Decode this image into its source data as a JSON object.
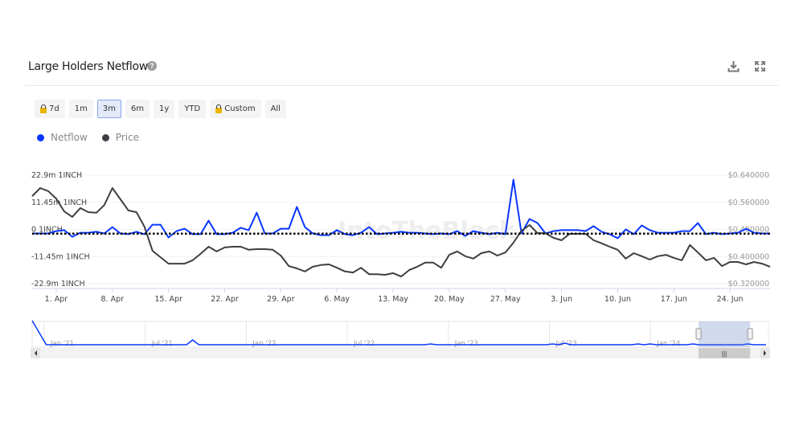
{
  "header": {
    "title": "Large Holders Netflow",
    "help_icon": "question-circle-icon",
    "download_icon": "download-icon",
    "fullscreen_icon": "expand-icon"
  },
  "range_buttons": [
    {
      "label": "7d",
      "locked": true
    },
    {
      "label": "1m",
      "locked": false
    },
    {
      "label": "3m",
      "locked": false,
      "active": true
    },
    {
      "label": "6m",
      "locked": false
    },
    {
      "label": "1y",
      "locked": false
    },
    {
      "label": "YTD",
      "locked": false
    },
    {
      "label": "Custom",
      "locked": true
    },
    {
      "label": "All",
      "locked": false
    }
  ],
  "legend": [
    {
      "label": "Netflow",
      "color": "#0a37ff"
    },
    {
      "label": "Price",
      "color": "#3d3f44"
    }
  ],
  "watermark": "IntoTheBlock",
  "chart_data": {
    "type": "line",
    "start_date": "2024-03-29",
    "x_tick_labels": [
      "1. Apr",
      "8. Apr",
      "15. Apr",
      "22. Apr",
      "29. Apr",
      "6. May",
      "13. May",
      "20. May",
      "27. May",
      "3. Jun",
      "10. Jun",
      "17. Jun",
      "24. Jun"
    ],
    "y_left": {
      "ticks": [
        "22.9m 1INCH",
        "11.45m 1INCH",
        "0 1INCH",
        "-11.45m 1INCH",
        "-22.9m 1INCH"
      ],
      "range": [
        -22.9,
        22.9
      ],
      "unit": "m 1INCH"
    },
    "y_right": {
      "ticks": [
        "$0.640000",
        "$0.560000",
        "$0.480000",
        "$0.400000",
        "$0.320000"
      ],
      "range": [
        0.32,
        0.64
      ],
      "unit": "USD"
    },
    "reference_line": -1.8,
    "grid": true,
    "series": [
      {
        "name": "Netflow",
        "axis": "left",
        "color": "#0a37ff",
        "values": [
          -1.7,
          -1.7,
          -1.7,
          -0.7,
          -0.3,
          -3.1,
          -1.4,
          -1.4,
          -1.0,
          -1.7,
          1.0,
          -1.7,
          -2.0,
          -1.0,
          -2.0,
          2.0,
          2.0,
          -3.4,
          -0.7,
          0.3,
          -2.0,
          -2.0,
          3.7,
          -2.0,
          -2.0,
          -1.4,
          0.7,
          -0.3,
          7.1,
          -1.7,
          -1.7,
          0.3,
          0.3,
          9.5,
          1.0,
          -1.7,
          -2.4,
          -2.4,
          -0.3,
          -2.0,
          -2.4,
          -1.4,
          1.0,
          -2.0,
          -1.7,
          -1.4,
          -1.0,
          -1.4,
          -1.4,
          -1.7,
          -2.0,
          -1.7,
          -2.0,
          -0.7,
          -2.7,
          -0.7,
          -1.4,
          -2.0,
          -1.4,
          -2.0,
          21.0,
          -1.7,
          4.4,
          2.7,
          -1.7,
          -0.7,
          -0.3,
          -0.3,
          -0.3,
          -0.7,
          1.4,
          -1.0,
          -2.0,
          -3.7,
          0,
          -2.0,
          1.7,
          -0.3,
          -1.4,
          -1.4,
          -1.4,
          -0.7,
          -0.7,
          2.7,
          -2.0,
          -1.4,
          -2.0,
          -1.7,
          -1.4,
          0.3,
          -1.4,
          -1.7,
          -1.7
        ]
      },
      {
        "name": "Price",
        "axis": "right",
        "color": "#3d3f44",
        "values": [
          0.578,
          0.602,
          0.593,
          0.571,
          0.533,
          0.517,
          0.543,
          0.531,
          0.529,
          0.552,
          0.602,
          0.569,
          0.536,
          0.531,
          0.488,
          0.417,
          0.398,
          0.379,
          0.379,
          0.379,
          0.389,
          0.408,
          0.429,
          0.415,
          0.427,
          0.429,
          0.429,
          0.42,
          0.422,
          0.422,
          0.42,
          0.403,
          0.372,
          0.365,
          0.356,
          0.37,
          0.375,
          0.377,
          0.367,
          0.356,
          0.353,
          0.367,
          0.348,
          0.348,
          0.346,
          0.351,
          0.341,
          0.36,
          0.37,
          0.382,
          0.382,
          0.367,
          0.405,
          0.415,
          0.401,
          0.394,
          0.41,
          0.415,
          0.403,
          0.412,
          0.441,
          0.476,
          0.493,
          0.469,
          0.469,
          0.455,
          0.448,
          0.467,
          0.467,
          0.467,
          0.448,
          0.439,
          0.429,
          0.42,
          0.394,
          0.41,
          0.401,
          0.391,
          0.401,
          0.405,
          0.396,
          0.389,
          0.434,
          0.412,
          0.389,
          0.396,
          0.372,
          0.384,
          0.384,
          0.377,
          0.384,
          0.379,
          0.37
        ]
      }
    ]
  },
  "navigator": {
    "labels": [
      "Jan '21",
      "Jul '21",
      "Jan '22",
      "Jul '22",
      "Jan '23",
      "Jul '23",
      "Jan '24"
    ],
    "values": [
      30,
      0,
      0,
      0,
      0,
      0,
      0,
      0,
      0,
      0,
      0,
      0,
      0,
      0,
      0,
      0,
      0,
      0,
      0,
      0,
      0,
      0,
      0,
      0,
      0,
      6,
      0,
      0,
      0,
      0,
      0,
      0,
      0,
      0,
      0,
      0,
      0,
      0,
      0,
      0,
      0,
      0,
      0,
      0,
      0,
      0,
      0,
      0,
      0,
      0,
      0,
      0,
      0,
      0,
      0,
      0,
      0,
      0,
      0,
      0,
      0,
      0,
      0,
      0,
      1,
      0,
      0,
      0,
      0,
      0,
      0,
      0,
      0,
      0,
      0,
      0,
      0,
      0,
      0,
      0,
      0,
      0,
      0,
      0,
      1,
      0,
      2,
      0,
      0,
      0,
      0,
      0,
      0,
      0,
      0,
      0,
      0,
      0,
      1,
      0,
      1,
      0,
      0,
      0,
      0,
      0,
      0,
      1,
      0,
      0,
      0,
      0,
      0,
      0,
      0,
      0,
      1,
      0,
      0,
      0
    ],
    "selected_fraction": [
      0.905,
      0.975
    ]
  }
}
